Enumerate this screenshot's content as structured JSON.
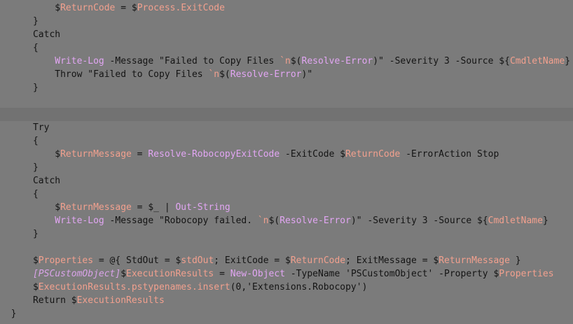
{
  "editor": {
    "current_line": 8,
    "lines": [
      {
        "indent": 10,
        "tokens": [
          {
            "t": "$",
            "k": "dollar"
          },
          {
            "t": "ReturnCode",
            "k": "var"
          },
          {
            "t": " = ",
            "k": "plain"
          },
          {
            "t": "$",
            "k": "dollar"
          },
          {
            "t": "Process.ExitCode",
            "k": "var"
          }
        ]
      },
      {
        "indent": 6,
        "tokens": [
          {
            "t": "}",
            "k": "plain"
          }
        ]
      },
      {
        "indent": 6,
        "tokens": [
          {
            "t": "Catch",
            "k": "kw"
          }
        ]
      },
      {
        "indent": 6,
        "tokens": [
          {
            "t": "{",
            "k": "plain"
          }
        ]
      },
      {
        "indent": 10,
        "tokens": [
          {
            "t": "Write-Log",
            "k": "cmd"
          },
          {
            "t": " -Message ",
            "k": "plain"
          },
          {
            "t": "\"Failed to Copy Files ",
            "k": "str"
          },
          {
            "t": "`n",
            "k": "esc"
          },
          {
            "t": "$(",
            "k": "plain"
          },
          {
            "t": "Resolve-Error",
            "k": "cmd"
          },
          {
            "t": ")\"",
            "k": "plain"
          },
          {
            "t": " -Severity 3 -Source ",
            "k": "plain"
          },
          {
            "t": "${",
            "k": "plain"
          },
          {
            "t": "CmdletName",
            "k": "var"
          },
          {
            "t": "}",
            "k": "plain"
          }
        ]
      },
      {
        "indent": 10,
        "tokens": [
          {
            "t": "Throw ",
            "k": "kw"
          },
          {
            "t": "\"Failed to Copy Files ",
            "k": "str"
          },
          {
            "t": "`n",
            "k": "esc"
          },
          {
            "t": "$(",
            "k": "plain"
          },
          {
            "t": "Resolve-Error",
            "k": "cmd"
          },
          {
            "t": ")\"",
            "k": "plain"
          }
        ]
      },
      {
        "indent": 6,
        "tokens": [
          {
            "t": "}",
            "k": "plain"
          }
        ]
      },
      {
        "indent": 0,
        "tokens": []
      },
      {
        "indent": 0,
        "tokens": []
      },
      {
        "indent": 6,
        "tokens": [
          {
            "t": "Try",
            "k": "kw"
          }
        ]
      },
      {
        "indent": 6,
        "tokens": [
          {
            "t": "{",
            "k": "plain"
          }
        ]
      },
      {
        "indent": 10,
        "tokens": [
          {
            "t": "$",
            "k": "dollar"
          },
          {
            "t": "ReturnMessage",
            "k": "var"
          },
          {
            "t": " = ",
            "k": "plain"
          },
          {
            "t": "Resolve-RobocopyExitCode",
            "k": "cmd"
          },
          {
            "t": " -ExitCode ",
            "k": "plain"
          },
          {
            "t": "$",
            "k": "dollar"
          },
          {
            "t": "ReturnCode",
            "k": "var"
          },
          {
            "t": " -ErrorAction Stop",
            "k": "plain"
          }
        ]
      },
      {
        "indent": 6,
        "tokens": [
          {
            "t": "}",
            "k": "plain"
          }
        ]
      },
      {
        "indent": 6,
        "tokens": [
          {
            "t": "Catch",
            "k": "kw"
          }
        ]
      },
      {
        "indent": 6,
        "tokens": [
          {
            "t": "{",
            "k": "plain"
          }
        ]
      },
      {
        "indent": 10,
        "tokens": [
          {
            "t": "$",
            "k": "dollar"
          },
          {
            "t": "ReturnMessage",
            "k": "var"
          },
          {
            "t": " = ",
            "k": "plain"
          },
          {
            "t": "$_",
            "k": "dollar"
          },
          {
            "t": " | ",
            "k": "plain"
          },
          {
            "t": "Out-String",
            "k": "cmd"
          }
        ]
      },
      {
        "indent": 10,
        "tokens": [
          {
            "t": "Write-Log",
            "k": "cmd"
          },
          {
            "t": " -Message ",
            "k": "plain"
          },
          {
            "t": "\"Robocopy failed. ",
            "k": "str"
          },
          {
            "t": "`n",
            "k": "esc"
          },
          {
            "t": "$(",
            "k": "plain"
          },
          {
            "t": "Resolve-Error",
            "k": "cmd"
          },
          {
            "t": ")\"",
            "k": "plain"
          },
          {
            "t": " -Severity 3 -Source ",
            "k": "plain"
          },
          {
            "t": "${",
            "k": "plain"
          },
          {
            "t": "CmdletName",
            "k": "var"
          },
          {
            "t": "}",
            "k": "plain"
          }
        ]
      },
      {
        "indent": 6,
        "tokens": [
          {
            "t": "}",
            "k": "plain"
          }
        ]
      },
      {
        "indent": 0,
        "tokens": []
      },
      {
        "indent": 6,
        "tokens": [
          {
            "t": "$",
            "k": "dollar"
          },
          {
            "t": "Properties",
            "k": "var"
          },
          {
            "t": " = @{ StdOut = ",
            "k": "plain"
          },
          {
            "t": "$",
            "k": "dollar"
          },
          {
            "t": "stdOut",
            "k": "var"
          },
          {
            "t": "; ExitCode = ",
            "k": "plain"
          },
          {
            "t": "$",
            "k": "dollar"
          },
          {
            "t": "ReturnCode",
            "k": "var"
          },
          {
            "t": "; ExitMessage = ",
            "k": "plain"
          },
          {
            "t": "$",
            "k": "dollar"
          },
          {
            "t": "ReturnMessage",
            "k": "var"
          },
          {
            "t": " }",
            "k": "plain"
          }
        ]
      },
      {
        "indent": 6,
        "tokens": [
          {
            "t": "[PSCustomObject]",
            "k": "type"
          },
          {
            "t": "$",
            "k": "dollar"
          },
          {
            "t": "ExecutionResults",
            "k": "var"
          },
          {
            "t": " = ",
            "k": "plain"
          },
          {
            "t": "New-Object",
            "k": "cmd"
          },
          {
            "t": " -TypeName ",
            "k": "plain"
          },
          {
            "t": "'PSCustomObject'",
            "k": "str"
          },
          {
            "t": " -Property ",
            "k": "plain"
          },
          {
            "t": "$",
            "k": "dollar"
          },
          {
            "t": "Properties",
            "k": "var"
          }
        ]
      },
      {
        "indent": 6,
        "tokens": [
          {
            "t": "$",
            "k": "dollar"
          },
          {
            "t": "ExecutionResults.pstypenames.insert",
            "k": "var"
          },
          {
            "t": "(0,",
            "k": "plain"
          },
          {
            "t": "'Extensions.Robocopy'",
            "k": "str"
          },
          {
            "t": ")",
            "k": "plain"
          }
        ]
      },
      {
        "indent": 6,
        "tokens": [
          {
            "t": "Return ",
            "k": "kw"
          },
          {
            "t": "$",
            "k": "dollar"
          },
          {
            "t": "ExecutionResults",
            "k": "var"
          }
        ]
      },
      {
        "indent": 2,
        "tokens": [
          {
            "t": "}",
            "k": "plain"
          }
        ]
      }
    ]
  },
  "colors": {
    "background": "#7b7b7b",
    "current_line": "#727272",
    "variable": "#f2a08e",
    "cmdlet": "#e2a6f3",
    "type": "#d9a3e8",
    "text": "#141414"
  }
}
